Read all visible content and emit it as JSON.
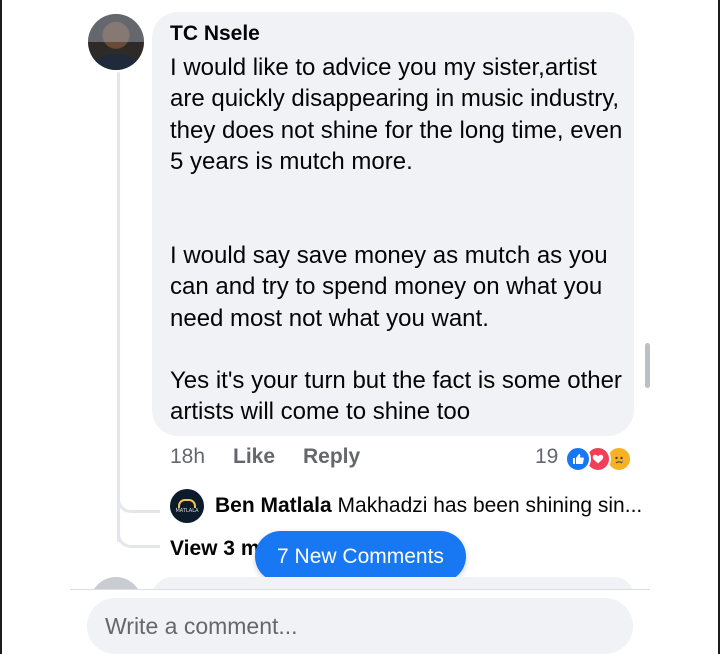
{
  "comment": {
    "author": "TC Nsele",
    "paragraphs": [
      "I would like to advice you my sister,artist are quickly disappearing in music industry, they does not shine for the long time, even 5 years is mutch more.",
      "I would say save money as mutch as you can and try to spend money on what you need most not what you want.",
      "Yes it's your turn but the fact is some other artists will come to shine too"
    ],
    "time": "18h",
    "like_label": "Like",
    "reply_label": "Reply",
    "reaction_count": "19",
    "reactions": [
      "like-icon",
      "love-icon",
      "sad-icon"
    ],
    "reaction_colors": {
      "like": "#1877f2",
      "love": "#f33e58",
      "sad": "#f7b125"
    }
  },
  "reply_preview": {
    "author": "Ben Matlala",
    "text": "Makhadzi has been shining sin...",
    "avatar_text": "MATLALA"
  },
  "view_more_label": "View 3 m",
  "new_comments_pill": "7 New Comments",
  "composer": {
    "placeholder": "Write a comment..."
  },
  "accent_color": "#1877f2"
}
